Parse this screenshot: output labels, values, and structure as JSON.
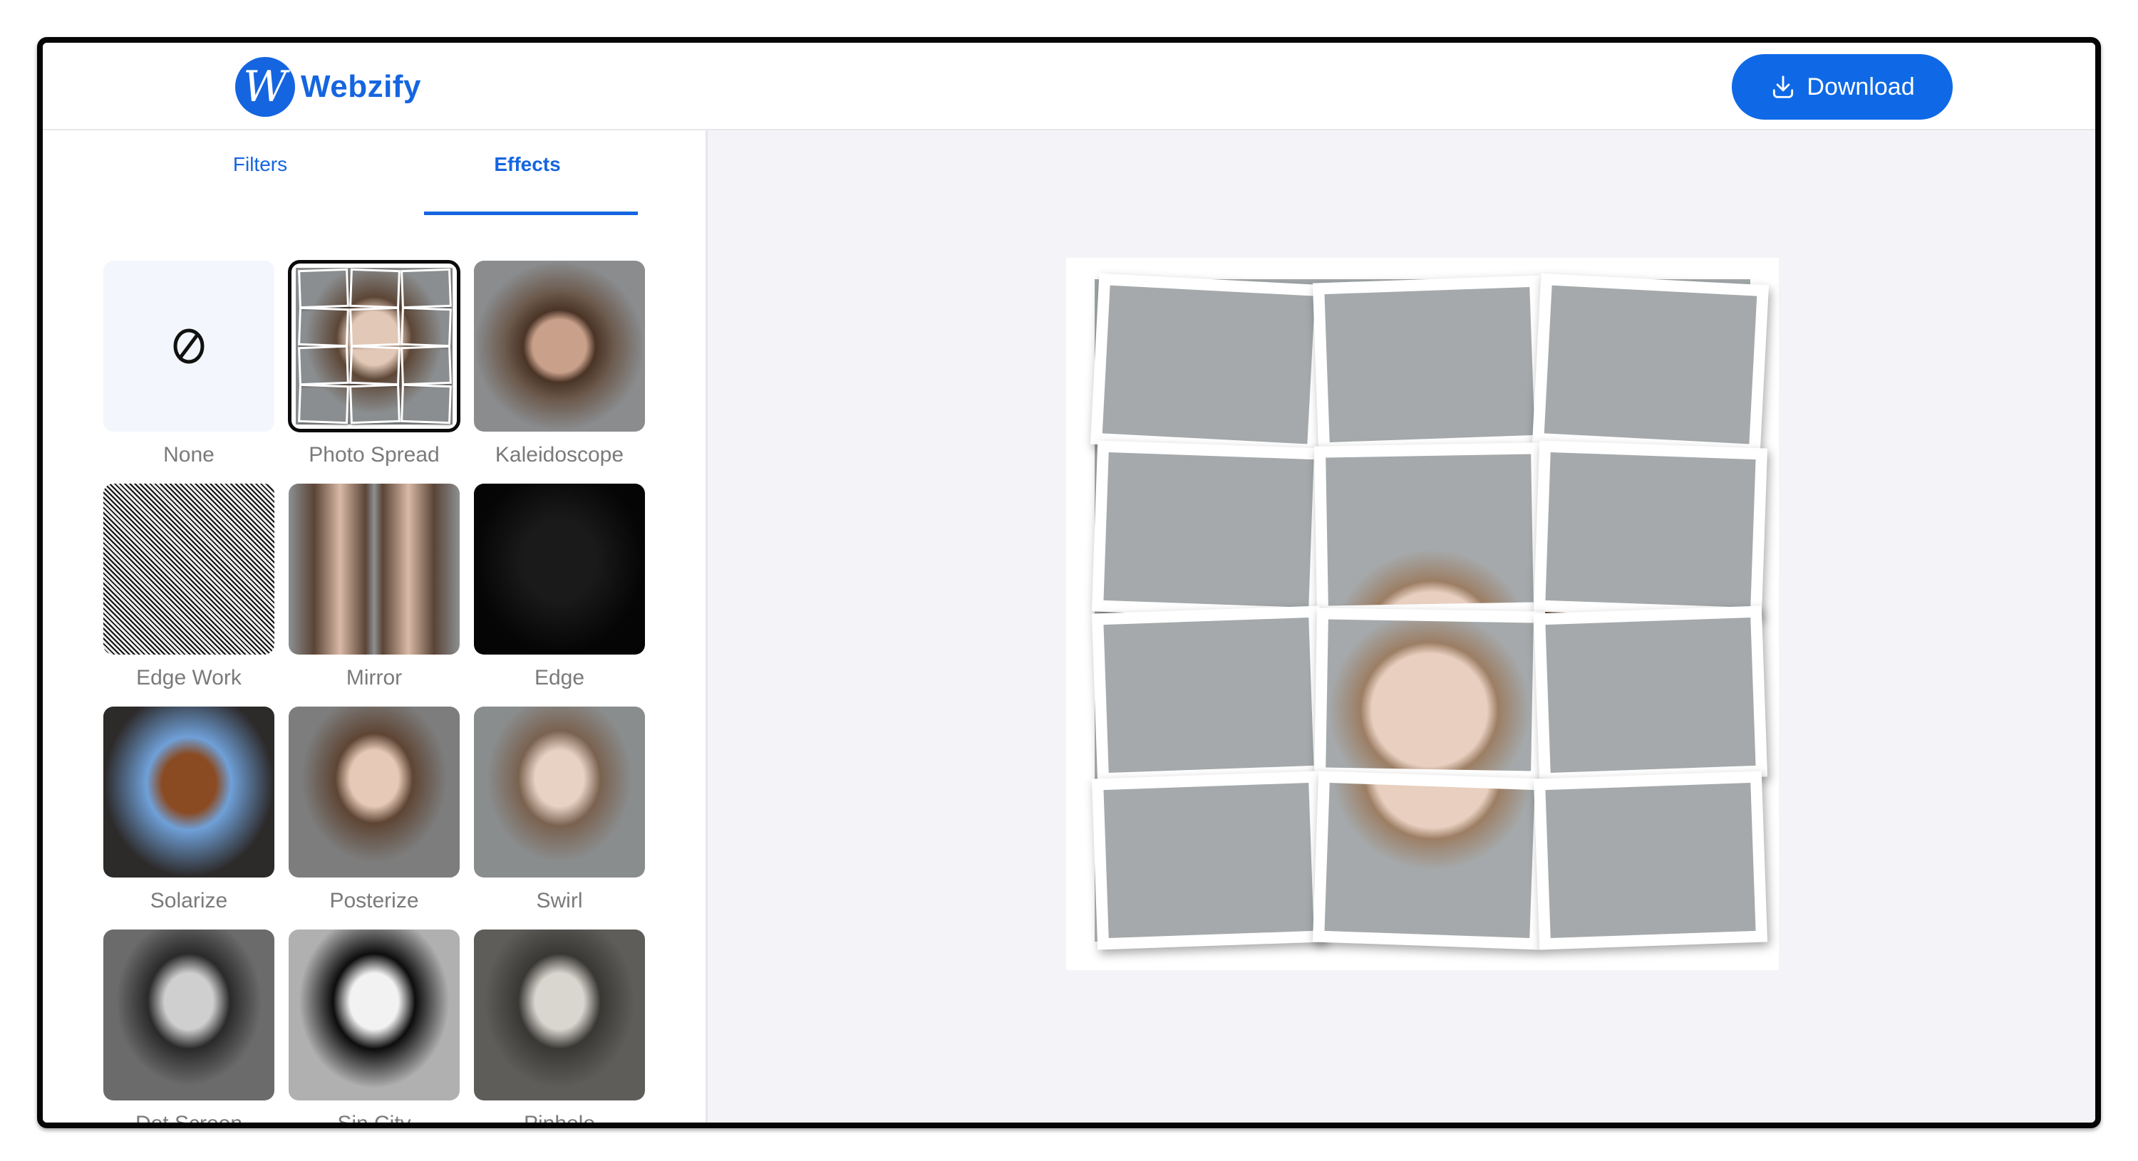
{
  "header": {
    "logo_letter": "W",
    "logo_text": "Webzify",
    "download_label": "Download",
    "download_icon": "download-icon"
  },
  "colors": {
    "accent": "#1565e0",
    "button": "#0f69e6",
    "label_gray": "#7a7a7a",
    "canvas_bg": "#f4f4f8"
  },
  "tabs": [
    {
      "label": "Filters",
      "active": false
    },
    {
      "label": "Effects",
      "active": true
    }
  ],
  "effects": [
    {
      "label": "None",
      "icon": "no-symbol-icon",
      "selected": false
    },
    {
      "label": "Photo Spread",
      "selected": true
    },
    {
      "label": "Kaleidoscope",
      "selected": false
    },
    {
      "label": "Edge Work",
      "selected": false
    },
    {
      "label": "Mirror",
      "selected": false
    },
    {
      "label": "Edge",
      "selected": false
    },
    {
      "label": "Solarize",
      "selected": false
    },
    {
      "label": "Posterize",
      "selected": false
    },
    {
      "label": "Swirl",
      "selected": false
    },
    {
      "label": "Dot Screen",
      "selected": false
    },
    {
      "label": "Sin City",
      "selected": false
    },
    {
      "label": "Pinhole",
      "selected": false
    }
  ],
  "preview": {
    "effect": "Photo Spread",
    "grid_rows": 4,
    "grid_cols": 3
  }
}
